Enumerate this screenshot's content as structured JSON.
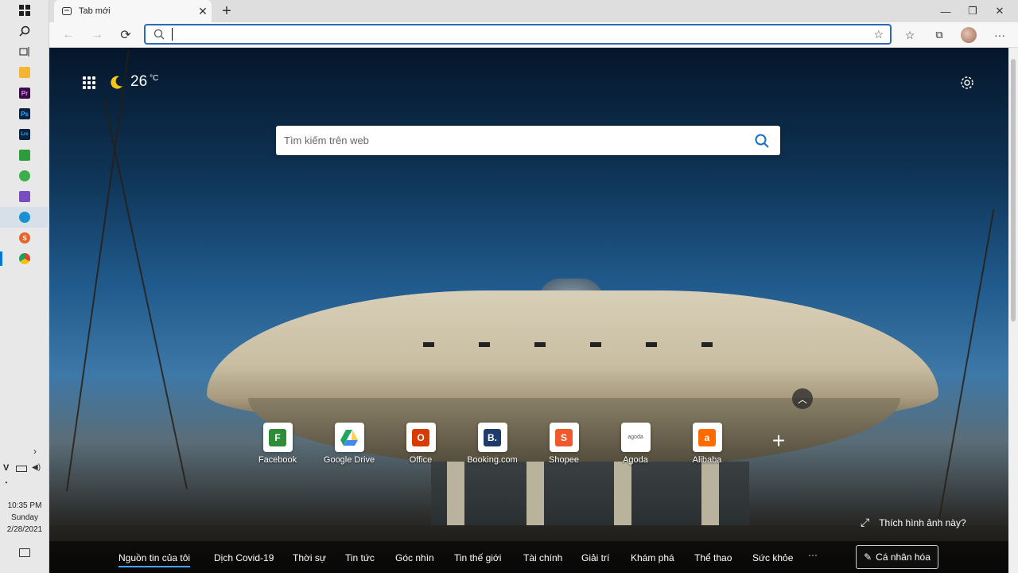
{
  "taskbar": {
    "apps": [
      {
        "name": "windows-start",
        "icon": "windows-logo-icon",
        "color": "#1f1f1f"
      },
      {
        "name": "search",
        "icon": "search-icon",
        "color": "#1f1f1f"
      },
      {
        "name": "task-view",
        "icon": "task-view-icon",
        "color": "#1f1f1f"
      },
      {
        "name": "file-explorer",
        "icon": "folder-icon",
        "color": "#f2b632"
      },
      {
        "name": "premiere-pro",
        "icon": "premiere-icon",
        "color": "#3b0b48",
        "text": "Pr"
      },
      {
        "name": "photoshop",
        "icon": "photoshop-icon",
        "color": "#0a2440",
        "text": "Ps"
      },
      {
        "name": "lightroom-classic",
        "icon": "lightroom-icon",
        "color": "#0a2440",
        "text": "Lrc"
      },
      {
        "name": "camtasia",
        "icon": "camtasia-icon",
        "color": "#2e9b3c"
      },
      {
        "name": "tool-green",
        "icon": "recycle-icon",
        "color": "#3ab04a"
      },
      {
        "name": "visual-studio",
        "icon": "visual-studio-icon",
        "color": "#7a4cc2"
      },
      {
        "name": "edge",
        "icon": "edge-icon",
        "color": "#1a8fd1"
      },
      {
        "name": "s-app",
        "icon": "s-app-icon",
        "color": "#e8642a",
        "text": "S"
      },
      {
        "name": "chrome",
        "icon": "chrome-icon",
        "color": "#d94235"
      }
    ],
    "clock": {
      "time": "10:35 PM",
      "day": "Sunday",
      "date": "2/28/2021"
    }
  },
  "browser": {
    "tab_title": "Tab mới",
    "address_value": "",
    "colors": {
      "accent": "#2b6ab7"
    }
  },
  "ntp": {
    "weather": {
      "temperature": "26",
      "unit": "°C"
    },
    "search_placeholder": "Tìm kiếm trên web",
    "quick_links": [
      {
        "label": "Facebook",
        "icon": "facebook-icon",
        "text": "F",
        "color": "#2f8d3a"
      },
      {
        "label": "Google Drive",
        "icon": "google-drive-icon",
        "text": "",
        "color": "#1fa463"
      },
      {
        "label": "Office",
        "icon": "office-icon",
        "text": "O",
        "color": "#d83b01"
      },
      {
        "label": "Booking.com",
        "icon": "booking-icon",
        "text": "B.",
        "color": "#1d3b6b"
      },
      {
        "label": "Shopee",
        "icon": "shopee-icon",
        "text": "S",
        "color": "#f1582c"
      },
      {
        "label": "Agoda",
        "icon": "agoda-icon",
        "text": "agoda",
        "color": "#ffffff"
      },
      {
        "label": "Alibaba",
        "icon": "alibaba-icon",
        "text": "a",
        "color": "#ff6a00"
      }
    ],
    "like_image_text": "Thích hình ảnh này?",
    "news_tabs": [
      "Nguồn tin của tôi",
      "Dịch Covid-19",
      "Thời sự",
      "Tin tức",
      "Góc nhìn",
      "Tin thế giới",
      "Tài chính",
      "Giải trí",
      "Khám phá",
      "Thể thao",
      "Sức khỏe"
    ],
    "news_more": "···",
    "personalize_label": "Cá nhân hóa"
  }
}
